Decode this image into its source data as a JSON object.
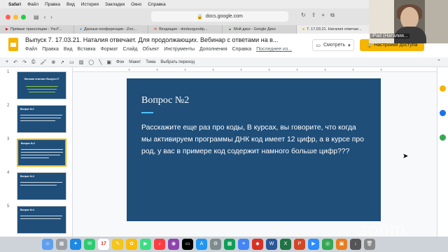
{
  "menubar": {
    "apple": "",
    "items": [
      "Safari",
      "Файл",
      "Правка",
      "Вид",
      "История",
      "Закладки",
      "Окно",
      "Справка"
    ]
  },
  "safari": {
    "url": "docs.google.com",
    "tabs": [
      {
        "label": "Прямые трансляции - YouT...",
        "active": false
      },
      {
        "label": "Данные конференции - Zoo...",
        "active": false
      },
      {
        "label": "Входящие - donburgundip...",
        "active": false
      },
      {
        "label": "Мой диск - Google Диск",
        "active": false
      },
      {
        "label": "7. 17.03.21. Наталия отвечае...",
        "active": true
      }
    ]
  },
  "docs": {
    "title": "Выпуск 7. 17.03.21. Наталия отвечает. Для продолжающих. Вебинар с ответами на в...",
    "menu": [
      "Файл",
      "Правка",
      "Вид",
      "Вставка",
      "Формат",
      "Слайд",
      "Объект",
      "Инструменты",
      "Дополнения",
      "Справка"
    ],
    "last_edit": "Последнее из...",
    "present_label": "Смотреть",
    "access_label": "Настройки доступа"
  },
  "toolbar": {
    "labels": [
      "Фон",
      "Макет",
      "Тема",
      "Выбрать переход"
    ]
  },
  "filmstrip": {
    "slides": [
      {
        "num": "1",
        "title": "Наталия отвечает Выпуск #7",
        "selected": false
      },
      {
        "num": "2",
        "title": "Вопрос №1",
        "selected": false
      },
      {
        "num": "3",
        "title": "Вопрос №2",
        "selected": true
      },
      {
        "num": "4",
        "title": "Вопрос №3",
        "selected": false
      },
      {
        "num": "5",
        "title": "Вопрос №4",
        "selected": false
      }
    ]
  },
  "slide": {
    "title": "Вопрос №2",
    "body": "Расскажите еще раз про коды, В курсах, вы говорите, что когда мы активируем программы ДНК код имеет 12 цифр, а в курсе про род, у вас в примере код содержит намного больше цифр???"
  },
  "webcam": {
    "name": "iPad (Наталия..."
  },
  "watermark": "zoom",
  "dock": {
    "calendar_day": "17"
  },
  "colors": {
    "slide_bg": "#1f4e79",
    "accent_yellow": "#f4b400",
    "underline": "#4fc3f7"
  }
}
